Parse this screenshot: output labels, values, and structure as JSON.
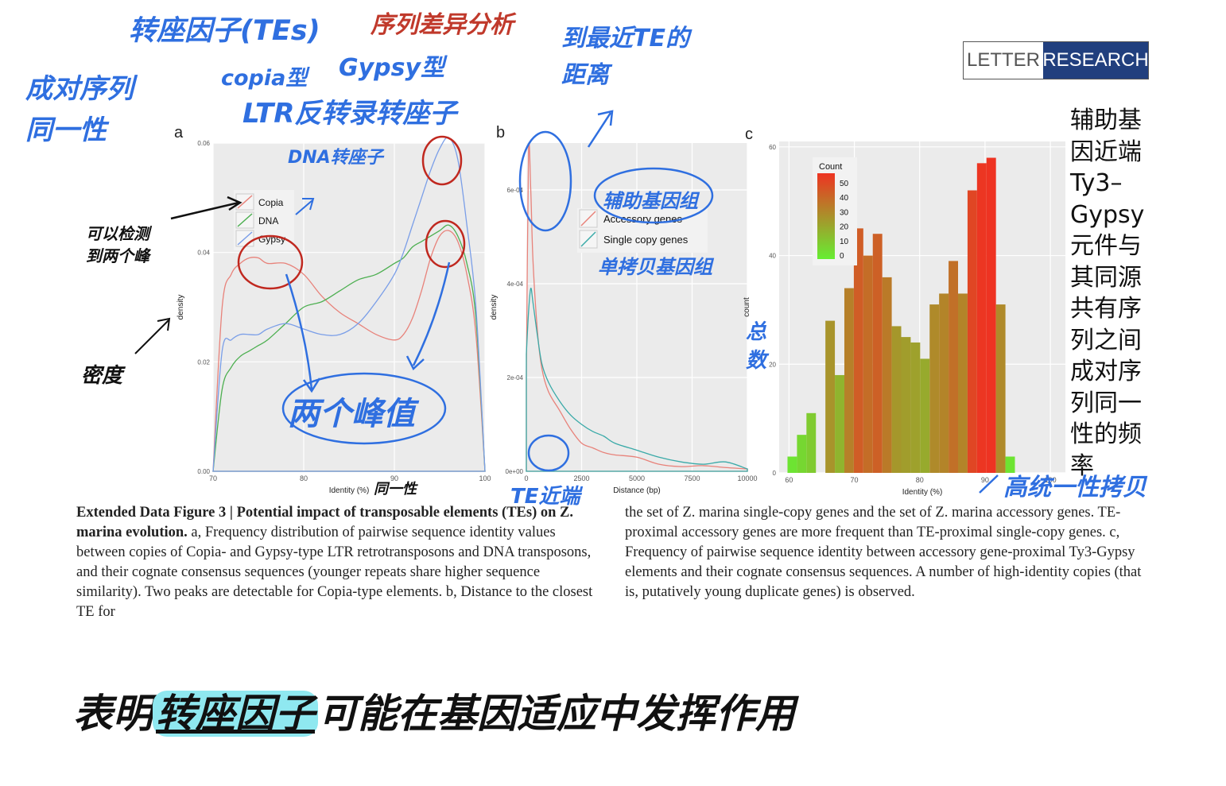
{
  "badge": {
    "left": "LETTER",
    "right": "RESEARCH"
  },
  "panels": {
    "a": "a",
    "b": "b",
    "c": "c"
  },
  "chart_data": [
    {
      "type": "line",
      "panel": "a",
      "xlabel": "Identity (%)",
      "ylabel": "density",
      "xlim": [
        70,
        100
      ],
      "ylim": [
        0,
        0.06
      ],
      "xticks": [
        "70",
        "80",
        "90",
        "100"
      ],
      "yticks": [
        "0.00",
        "0.02",
        "0.04",
        "0.06"
      ],
      "legend": [
        "Copia",
        "DNA",
        "Gypsy"
      ],
      "legend_position": "top-left",
      "series": [
        {
          "name": "Copia",
          "color": "#e8827a",
          "x": [
            70,
            71,
            72,
            73,
            74,
            75,
            76,
            78,
            80,
            82,
            84,
            86,
            88,
            90,
            91,
            92,
            93,
            94,
            95,
            96,
            97,
            98,
            99,
            100
          ],
          "y": [
            0,
            0.03,
            0.036,
            0.038,
            0.039,
            0.039,
            0.038,
            0.038,
            0.036,
            0.032,
            0.029,
            0.027,
            0.025,
            0.024,
            0.025,
            0.028,
            0.033,
            0.039,
            0.043,
            0.044,
            0.042,
            0.036,
            0.025,
            0
          ]
        },
        {
          "name": "DNA",
          "color": "#4caf50",
          "x": [
            70,
            71,
            72,
            73,
            74,
            75,
            76,
            78,
            80,
            82,
            84,
            86,
            88,
            90,
            91,
            92,
            93,
            94,
            95,
            96,
            97,
            98,
            99,
            100
          ],
          "y": [
            0,
            0.015,
            0.019,
            0.021,
            0.022,
            0.023,
            0.024,
            0.027,
            0.03,
            0.031,
            0.033,
            0.035,
            0.036,
            0.038,
            0.039,
            0.041,
            0.042,
            0.043,
            0.044,
            0.045,
            0.043,
            0.038,
            0.028,
            0
          ]
        },
        {
          "name": "Gypsy",
          "color": "#7a9ee8",
          "x": [
            70,
            71,
            72,
            73,
            74,
            75,
            76,
            78,
            80,
            82,
            84,
            86,
            88,
            90,
            91,
            92,
            93,
            94,
            95,
            96,
            97,
            98,
            99,
            100
          ],
          "y": [
            0,
            0.022,
            0.024,
            0.025,
            0.025,
            0.025,
            0.026,
            0.027,
            0.026,
            0.025,
            0.025,
            0.027,
            0.031,
            0.036,
            0.04,
            0.045,
            0.05,
            0.055,
            0.059,
            0.061,
            0.057,
            0.045,
            0.03,
            0
          ]
        }
      ]
    },
    {
      "type": "line",
      "panel": "b",
      "xlabel": "Distance (bp)",
      "ylabel": "density",
      "xlim": [
        0,
        10000
      ],
      "ylim": [
        0,
        0.0007
      ],
      "xticks": [
        "0",
        "2500",
        "5000",
        "7500",
        "10000"
      ],
      "yticks": [
        "0e+00",
        "2e-04",
        "4e-04",
        "6e-04"
      ],
      "legend": [
        "Accessory genes",
        "Single copy genes"
      ],
      "legend_position": "top-right",
      "series": [
        {
          "name": "Accessory genes",
          "color": "#e8827a",
          "x": [
            0,
            100,
            200,
            300,
            500,
            700,
            1000,
            1500,
            2000,
            2500,
            3000,
            3500,
            4000,
            5000,
            6000,
            7000,
            8000,
            9000,
            10000
          ],
          "y": [
            0.0002,
            0.00068,
            0.0006,
            0.00045,
            0.0003,
            0.00022,
            0.00017,
            0.00013,
            9e-05,
            6e-05,
            5e-05,
            4e-05,
            3.5e-05,
            3e-05,
            1.5e-05,
            1e-05,
            1.2e-05,
            8e-06,
            5e-06
          ]
        },
        {
          "name": "Single copy genes",
          "color": "#3aaaa8",
          "x": [
            0,
            100,
            200,
            300,
            500,
            700,
            1000,
            1500,
            2000,
            2500,
            3000,
            3500,
            4000,
            5000,
            6000,
            7000,
            8000,
            9000,
            10000
          ],
          "y": [
            0.00025,
            0.00034,
            0.00039,
            0.00036,
            0.00029,
            0.00023,
            0.00019,
            0.00015,
            0.00012,
            0.0001,
            8.5e-05,
            7.5e-05,
            6e-05,
            4.5e-05,
            3e-05,
            2e-05,
            1.5e-05,
            2e-05,
            5e-06
          ]
        }
      ]
    },
    {
      "type": "bar",
      "panel": "c",
      "xlabel": "Identity (%)",
      "ylabel": "count",
      "xlim": [
        58.5,
        102.3
      ],
      "ylim": [
        0,
        61
      ],
      "xticks": [
        "60",
        "70",
        "80",
        "90",
        "100"
      ],
      "yticks": [
        "0",
        "20",
        "40",
        "60"
      ],
      "legend_title": "Count",
      "legend_ticks": [
        "50",
        "40",
        "30",
        "20",
        "10",
        "0"
      ],
      "legend_position": "top-left",
      "color_low": "#66ee33",
      "color_high": "#ee3322",
      "bin_width": 1.45,
      "x": [
        60.5,
        61.95,
        63.4,
        64.85,
        66.3,
        67.75,
        69.2,
        70.65,
        72.1,
        73.55,
        75.0,
        76.45,
        77.9,
        79.35,
        80.8,
        82.25,
        83.7,
        85.15,
        86.6,
        88.05,
        89.5,
        90.95,
        92.4,
        93.85,
        95.3,
        96.75,
        98.2,
        99.65
      ],
      "values": [
        3,
        7,
        11,
        0,
        28,
        18,
        34,
        45,
        40,
        44,
        36,
        27,
        25,
        24,
        21,
        31,
        33,
        39,
        33,
        52,
        57,
        58,
        31,
        3
      ]
    }
  ],
  "caption_left": {
    "bold": "Extended Data Figure 3 | Potential impact of transposable elements (TEs) on Z. marina evolution.",
    "text": "a, Frequency distribution of pairwise sequence identity values between copies of Copia- and Gypsy-type LTR retrotransposons and DNA transposons, and their cognate consensus sequences (younger repeats share higher sequence similarity). Two peaks are detectable for Copia-type elements. b, Distance to the closest TE for"
  },
  "caption_right": {
    "text": "the set of Z. marina single-copy genes and the set of Z. marina accessory genes. TE-proximal accessory genes are more frequent than TE-proximal single-copy genes. c, Frequency of pairwise sequence identity between accessory gene-proximal Ty3-Gypsy elements and their cognate consensus sequences. A number of high-identity copies (that is, putatively young duplicate genes) is observed."
  },
  "side_note": "辅助基因近端Ty3–Gypsy元件与其同源共有序列之间成对序列同一性的频率",
  "annotations": {
    "te_title": "转座因子(TEs)",
    "seq_diff": "序列差异分析",
    "pairwise_identity": "成对序列同一性",
    "copia": "copia型",
    "gypsy": "Gypsy型",
    "ltr": "LTR反转录转座子",
    "dna_transposon": "DNA转座子",
    "two_peaks_note": "可以检测到两个峰",
    "density_note": "密度",
    "two_peaks": "两个峰值",
    "identity_note": "同一性",
    "nearest_te": "到最近TE的距离",
    "accessory": "辅助基因组",
    "single_copy": "单拷贝基因组",
    "te_proximal": "TE近端",
    "total": "总数",
    "high_identity": "高统一性拷贝",
    "conclusion_prefix": "表明",
    "conclusion_highlight": "转座因子",
    "conclusion_suffix": "可能在基因适应中发挥作用"
  }
}
